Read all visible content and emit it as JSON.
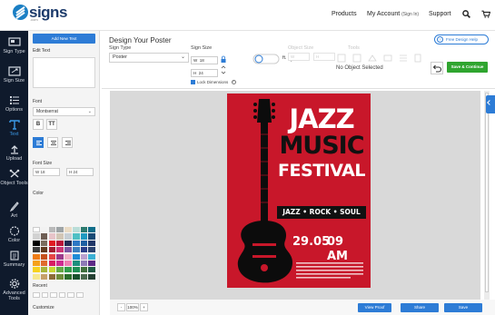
{
  "header": {
    "logo_text": "signs",
    "logo_sub": ".com",
    "nav": {
      "products": "Products",
      "account": "My Account",
      "sign_in": "(Sign In)",
      "support": "Support"
    },
    "icons": [
      "search-icon",
      "cart-icon"
    ]
  },
  "sidebar": {
    "items": [
      {
        "label": "Sign Type",
        "icon": "sign-type-icon"
      },
      {
        "label": "Sign Size",
        "icon": "sign-size-icon"
      },
      {
        "label": "Options",
        "icon": "options-icon"
      },
      {
        "label": "Text",
        "icon": "text-icon",
        "active": true
      },
      {
        "label": "Upload",
        "icon": "upload-icon"
      },
      {
        "label": "Object Tools",
        "icon": "object-tools-icon"
      },
      {
        "label": "Art",
        "icon": "art-icon"
      },
      {
        "label": "Color",
        "icon": "color-icon"
      },
      {
        "label": "Summary",
        "icon": "summary-icon"
      },
      {
        "label": "Advanced Tools",
        "icon": "advanced-tools-icon"
      }
    ]
  },
  "panel": {
    "add_text_button": "Add New Text",
    "edit_text_label": "Edit Text",
    "font_label": "Font",
    "font_value": "Montserrat",
    "bold": "B",
    "tt": "TT",
    "font_size_label": "Font Size",
    "font_size_w": "18",
    "font_size_h": "24",
    "color_label": "Color",
    "recent_label": "Recent",
    "customize_label": "Customize",
    "swatches": [
      "#ffffff",
      "#f2f2f2",
      "#b9b9b9",
      "#9ea4a6",
      "#eadcc6",
      "#b9ddd8",
      "#2c7b6f",
      "#0f6e8a",
      "#d2d2d2",
      "#6e5e54",
      "#e7c4c9",
      "#d2c6b6",
      "#c7cfd5",
      "#4ec0c4",
      "#1f9ac0",
      "#194b75",
      "#000000",
      "#7b6c5d",
      "#e01b22",
      "#b9123a",
      "#222b55",
      "#2d77c4",
      "#1d5fa3",
      "#203768",
      "#3d3d3d",
      "#603a1f",
      "#a61c30",
      "#cc3574",
      "#7a55a2",
      "#3c7fc0",
      "#2a3e8a",
      "#2a4370",
      "#ef7d17",
      "#c5501c",
      "#e64646",
      "#9c3a8b",
      "#f1b1c6",
      "#1f8bd6",
      "#bba1cf",
      "#3bb0d4",
      "#f5a11a",
      "#e06b2d",
      "#d71d64",
      "#cd2c91",
      "#ee7cb1",
      "#1c8e7c",
      "#8e79b6",
      "#5c2a86",
      "#f7d21f",
      "#a8b53a",
      "#c9d631",
      "#63a844",
      "#2f9c4a",
      "#1d8e53",
      "#3f6f3d",
      "#1e5a44",
      "#f6e88f",
      "#c6a06a",
      "#8c6c38",
      "#6f8c3a",
      "#2c6e2c",
      "#18512e",
      "#4b6a4f",
      "#244032"
    ]
  },
  "toolbar": {
    "design_title": "Design Your Poster",
    "sign_type_label": "Sign Type",
    "sign_type_value": "Poster",
    "sign_size_label": "Sign Size",
    "width_prefix": "W",
    "width_value": "18",
    "height_prefix": "H",
    "height_value": "24",
    "lock_dimensions": "Lock Dimensions",
    "ft_label": "ft.",
    "object_size_label": "Object Size",
    "tools_label": "Tools",
    "no_object": "No Object Selected",
    "help": "Free Design Help",
    "save_continue": "Save & Continue"
  },
  "poster": {
    "line1": "JAZZ",
    "line2": "MUSIC",
    "line3": "FESTIVAL",
    "tagline": "JAZZ • ROCK • SOUL",
    "date": "29.05",
    "time": "09 AM"
  },
  "bottombar": {
    "zoom_minus": "-",
    "zoom_value": "100%",
    "zoom_plus": "+",
    "view_proof": "View Proof",
    "share": "Share",
    "save": "Save"
  },
  "colors": {
    "accent": "#2d7cd6",
    "sidebar": "#0f1a2c",
    "poster_red": "#c8172a",
    "green": "#2fa52f"
  }
}
